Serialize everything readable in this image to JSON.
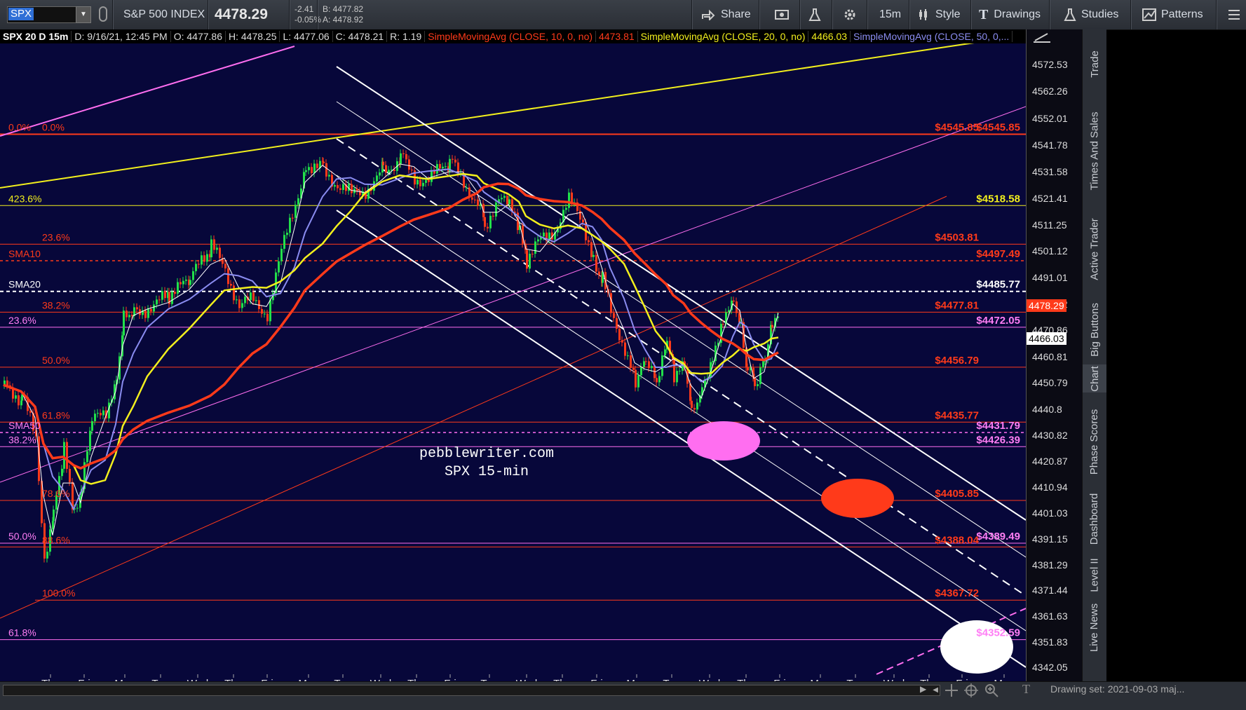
{
  "toolbar": {
    "symbol": "SPX",
    "index_name": "S&P 500 INDEX",
    "last_price": "4478.29",
    "change": "-2.41",
    "change_pct": "-0.05%",
    "bid": "B: 4477.82",
    "ask": "A: 4478.92",
    "share": "Share",
    "timeframe": "15m",
    "style": "Style",
    "drawings": "Drawings",
    "studies": "Studies",
    "patterns": "Patterns"
  },
  "infobar": {
    "symbol_tf": "SPX 20 D 15m",
    "date": "D: 9/16/21, 12:45 PM",
    "open": "O: 4477.86",
    "high": "H: 4478.25",
    "low": "L: 4477.06",
    "close": "C: 4478.21",
    "range": "R: 1.19",
    "sma10_label": "SimpleMovingAvg (CLOSE, 10, 0, no)",
    "sma10_val": "4473.81",
    "sma20_label": "SimpleMovingAvg (CLOSE, 20, 0, no)",
    "sma20_val": "4466.03",
    "sma50_label": "SimpleMovingAvg (CLOSE, 50, 0,..."
  },
  "colors": {
    "background": "#07073a",
    "red": "#ff3a1a",
    "yellow": "#f2ef1d",
    "white": "#ffffff",
    "magenta": "#ff6ef0",
    "blue_sma": "#8a8cf0",
    "pink_label": "#ff7ef5"
  },
  "price_axis": [
    "4572.53",
    "4562.26",
    "4552.01",
    "4541.78",
    "4531.58",
    "4521.41",
    "4511.25",
    "4501.12",
    "4491.01",
    "4480.92",
    "4470.86",
    "4460.81",
    "4450.79",
    "4440.8",
    "4430.82",
    "4420.87",
    "4410.94",
    "4401.03",
    "4391.15",
    "4381.29",
    "4371.44",
    "4361.63",
    "4351.83",
    "4342.05"
  ],
  "price_tags": {
    "last": "4478.29",
    "sma20": "4466.03"
  },
  "time_axis": [
    "Thu",
    "Fri",
    "Mon",
    "Tue",
    "Wed",
    "Thu",
    "Fri",
    "Mon",
    "Tue",
    "Wed",
    "Thu",
    "Fri",
    "Tue",
    "Wed",
    "Thu",
    "Fri",
    "Mon",
    "Tue",
    "Wed",
    "Thu",
    "Fri",
    "Mon",
    "Tue",
    "Wed",
    "Thu",
    "Fri",
    "Mon",
    "Tue",
    "Wed",
    "Thu",
    "Fri"
  ],
  "fib_labels_left": [
    "0.0%",
    "0.0%",
    "423.6%",
    "23.6%",
    "SMA10",
    "SMA20",
    "38.2%",
    "23.6%",
    "50.0%",
    "61.8%",
    "SMA50",
    "38.2%",
    "78.6%",
    "50.0%",
    "88.6%",
    "100.0%",
    "61.8%"
  ],
  "level_labels": {
    "l4545a": "$4545.85",
    "l4545b": "$4545.85",
    "l4518": "$4518.58",
    "l4503": "$4503.81",
    "l4497": "$4497.49",
    "l4485": "$4485.77",
    "l4477": "$4477.81",
    "l4472": "$4472.05",
    "l4456": "$4456.79",
    "l4435": "$4435.77",
    "l4431": "$4431.79",
    "l4426": "$4426.39",
    "l4405": "$4405.85",
    "l4389": "$4389.49",
    "l4388": "$4388.04",
    "l4367": "$4367.72",
    "l4352": "$4352.59"
  },
  "watermark": {
    "line1": "pebblewriter.com",
    "line2": "SPX 15-min"
  },
  "side_tabs": [
    "Trade",
    "Times And Sales",
    "Active Trader",
    "Big Buttons",
    "Chart",
    "Phase Scores",
    "Dashboard",
    "Level II",
    "Live News"
  ],
  "bottom": {
    "drawing_set": "Drawing set: 2021-09-03 maj..."
  }
}
